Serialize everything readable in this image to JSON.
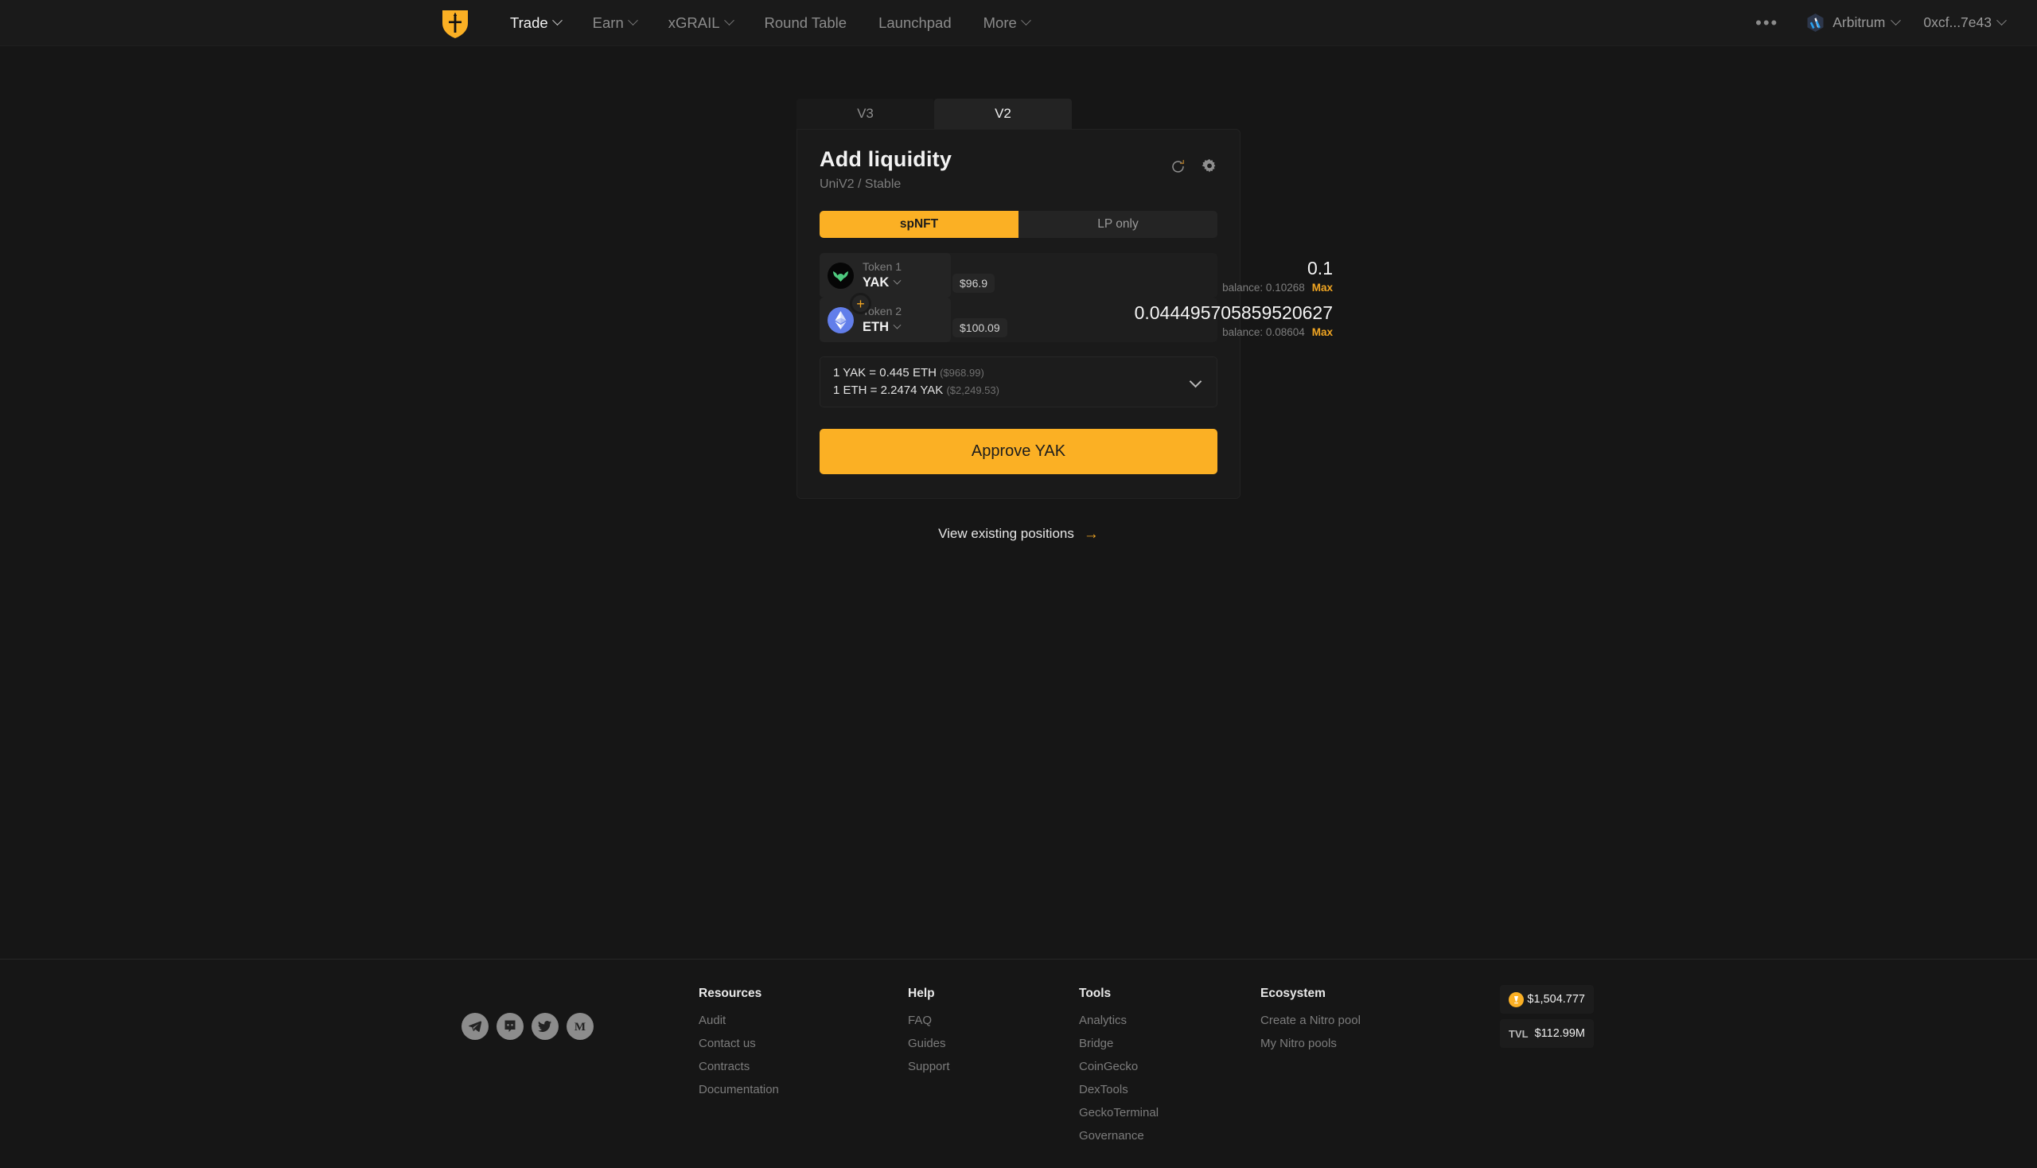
{
  "nav": {
    "logo_icon": "camelot-shield-sword-logo",
    "items": [
      {
        "label": "Trade",
        "has_caret": true,
        "active": true
      },
      {
        "label": "Earn",
        "has_caret": true,
        "active": false
      },
      {
        "label": "xGRAIL",
        "has_caret": true,
        "active": false
      },
      {
        "label": "Round Table",
        "has_caret": false,
        "active": false
      },
      {
        "label": "Launchpad",
        "has_caret": false,
        "active": false
      },
      {
        "label": "More",
        "has_caret": true,
        "active": false
      }
    ],
    "more_dots": "•••",
    "chain": {
      "label": "Arbitrum",
      "icon": "arbitrum-icon"
    },
    "wallet": {
      "label": "0xcf...7e43"
    }
  },
  "version_tabs": [
    {
      "label": "V3",
      "active": false
    },
    {
      "label": "V2",
      "active": true
    }
  ],
  "card": {
    "title": "Add liquidity",
    "subtitle": "UniV2 / Stable",
    "refresh_icon": "refresh-icon",
    "settings_icon": "gear-icon",
    "mode_tabs": [
      {
        "label": "spNFT",
        "active": true
      },
      {
        "label": "LP only",
        "active": false
      }
    ],
    "tokens": [
      {
        "slot_label": "Token 1",
        "symbol": "YAK",
        "logo_icon": "yak-token-icon",
        "amount": "0.1",
        "usd": "$96.9",
        "balance_label": "balance: 0.10268",
        "max_label": "Max",
        "placeholder": "0.0"
      },
      {
        "slot_label": "Token 2",
        "symbol": "ETH",
        "logo_icon": "ethereum-token-icon",
        "amount": "0.044495705859520627",
        "usd": "$100.09",
        "balance_label": "balance: 0.08604",
        "max_label": "Max",
        "placeholder": "0.0"
      }
    ],
    "plus_icon": "plus-icon",
    "rate": {
      "line1": "1 YAK = 0.445 ETH",
      "line1_usd": "($968.99)",
      "line2": "1 ETH = 2.2474 YAK",
      "line2_usd": "($2,249.53)",
      "expand_icon": "chevron-down-icon"
    },
    "cta_label": "Approve YAK",
    "view_positions_label": "View existing positions",
    "view_positions_arrow": "arrow-right-icon"
  },
  "footer": {
    "socials": [
      {
        "name": "telegram-icon"
      },
      {
        "name": "discord-icon"
      },
      {
        "name": "twitter-icon"
      },
      {
        "name": "medium-icon"
      }
    ],
    "columns": [
      {
        "title": "Resources",
        "links": [
          "Audit",
          "Contact us",
          "Contracts",
          "Documentation"
        ]
      },
      {
        "title": "Help",
        "links": [
          "FAQ",
          "Guides",
          "Support"
        ]
      },
      {
        "title": "Tools",
        "links": [
          "Analytics",
          "Bridge",
          "CoinGecko",
          "DexTools",
          "GeckoTerminal",
          "Governance"
        ]
      },
      {
        "title": "Ecosystem",
        "links": [
          "Create a Nitro pool",
          "My Nitro pools"
        ]
      }
    ],
    "stats": [
      {
        "key": "",
        "key_icon": "grail-token-icon",
        "value": "$1,504.777"
      },
      {
        "key": "TVL",
        "key_icon": "",
        "value": "$112.99M"
      }
    ]
  },
  "colors": {
    "accent": "#fbb024",
    "bg": "#161616",
    "card": "#1a1a1a",
    "muted": "#7c7c7c"
  }
}
